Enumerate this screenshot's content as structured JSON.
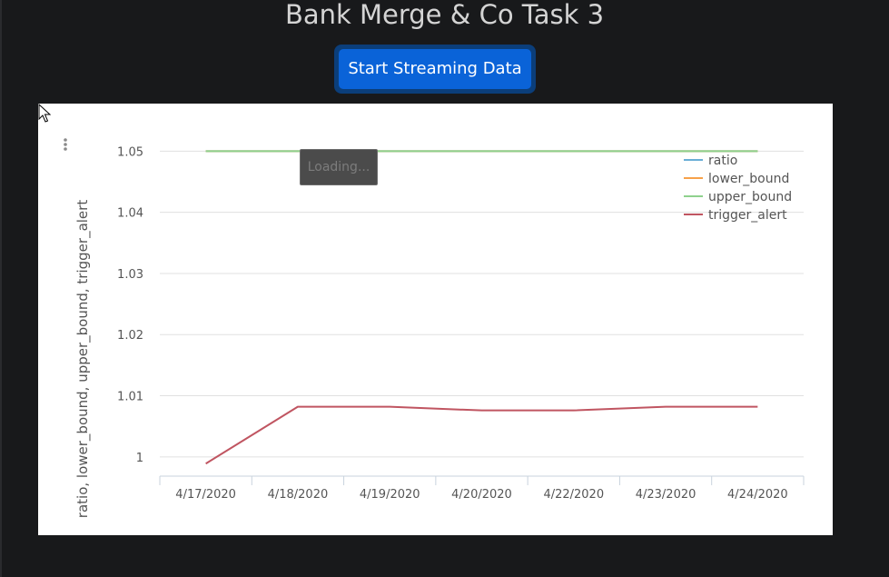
{
  "page": {
    "title": "Bank Merge & Co Task 3"
  },
  "toolbar": {
    "stream_label": "Start Streaming Data"
  },
  "tooltip": {
    "text": "Loading..."
  },
  "menu": {
    "icon": "vertical-ellipsis-icon"
  },
  "colors": {
    "background": "#18191b",
    "button": "#0a63d8",
    "ratio": "#6aaed6",
    "lower_bound": "#f7a14a",
    "upper_bound": "#8fd18d",
    "trigger_alert": "#c05561",
    "grid": "#e0e0e0"
  },
  "chart_data": {
    "type": "line",
    "ylabel": "ratio, lower_bound, upper_bound, trigger_alert",
    "xlabel": "",
    "categories": [
      "4/17/2020",
      "4/18/2020",
      "4/19/2020",
      "4/20/2020",
      "4/22/2020",
      "4/23/2020",
      "4/24/2020"
    ],
    "yticks": [
      "1",
      "1.01",
      "1.02",
      "1.03",
      "1.04",
      "1.05"
    ],
    "ylim": [
      0.997,
      1.0505
    ],
    "grid": true,
    "legend_position": "top-right",
    "legend": [
      "ratio",
      "lower_bound",
      "upper_bound",
      "trigger_alert"
    ],
    "series": [
      {
        "name": "ratio",
        "color": "#6aaed6",
        "values": [
          1.05,
          1.05,
          1.05,
          1.05,
          1.05,
          1.05,
          1.05
        ]
      },
      {
        "name": "lower_bound",
        "color": "#f7a14a",
        "values": [
          1.05,
          1.05,
          1.05,
          1.05,
          1.05,
          1.05,
          1.05
        ]
      },
      {
        "name": "upper_bound",
        "color": "#8fd18d",
        "values": [
          1.05,
          1.05,
          1.05,
          1.05,
          1.05,
          1.05,
          1.05
        ]
      },
      {
        "name": "trigger_alert",
        "color": "#c05561",
        "values": [
          0.9989,
          1.0082,
          1.0082,
          1.0076,
          1.0076,
          1.0082,
          1.0082
        ]
      }
    ]
  }
}
